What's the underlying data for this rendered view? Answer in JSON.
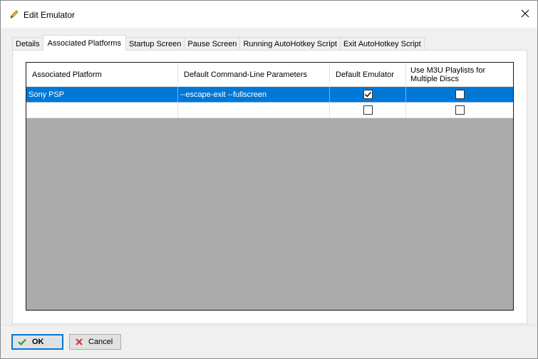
{
  "window": {
    "title": "Edit Emulator",
    "title_icon": "pencil-icon",
    "close_icon": "close-icon"
  },
  "tabs": [
    {
      "label": "Details",
      "active": false
    },
    {
      "label": "Associated Platforms",
      "active": true
    },
    {
      "label": "Startup Screen",
      "active": false
    },
    {
      "label": "Pause Screen",
      "active": false
    },
    {
      "label": "Running AutoHotkey Script",
      "active": false
    },
    {
      "label": "Exit AutoHotkey Script",
      "active": false
    }
  ],
  "grid": {
    "columns": [
      "Associated Platform",
      "Default Command-Line Parameters",
      "Default Emulator",
      "Use M3U Playlists for Multiple Discs"
    ],
    "rows": [
      {
        "platform": "Sony PSP",
        "parameters": "--escape-exit --fullscreen",
        "default_emulator": true,
        "use_m3u": false,
        "selected": true
      },
      {
        "platform": "",
        "parameters": "",
        "default_emulator": false,
        "use_m3u": false,
        "selected": false
      }
    ]
  },
  "buttons": {
    "ok_label": "OK",
    "ok_icon": "checkmark-icon",
    "cancel_label": "Cancel",
    "cancel_icon": "x-icon"
  },
  "colors": {
    "selection": "#0078d7",
    "grid_empty_area": "#ababab",
    "ok_check": "#2e9d32",
    "cancel_x": "#d32f2f"
  }
}
